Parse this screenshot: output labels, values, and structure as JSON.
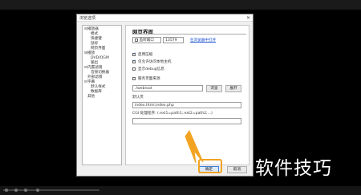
{
  "dialog": {
    "title": "浏览选项",
    "close_glyph": "✕"
  },
  "tree": {
    "items": [
      {
        "label": "播放器",
        "toggle": "⊟",
        "indent": 0
      },
      {
        "label": "模式",
        "toggle": "",
        "indent": 1
      },
      {
        "label": "快捷键",
        "toggle": "",
        "indent": 1
      },
      {
        "label": "鼠标",
        "toggle": "",
        "indent": 1
      },
      {
        "label": "网页界面",
        "toggle": "",
        "indent": 1
      },
      {
        "label": "播放",
        "toggle": "⊞",
        "indent": 0
      },
      {
        "label": "DVD/OGM",
        "toggle": "",
        "indent": 1
      },
      {
        "label": "输出",
        "toggle": "",
        "indent": 1
      },
      {
        "label": "内置滤镜",
        "toggle": "⊟",
        "indent": 0
      },
      {
        "label": "音频切换器",
        "toggle": "",
        "indent": 1
      },
      {
        "label": "外部滤镜",
        "toggle": "",
        "indent": 0
      },
      {
        "label": "字幕",
        "toggle": "⊟",
        "indent": 0
      },
      {
        "label": "默认样式",
        "toggle": "",
        "indent": 1
      },
      {
        "label": "数据库",
        "toggle": "",
        "indent": 1
      },
      {
        "label": "其他",
        "toggle": "",
        "indent": 0
      }
    ]
  },
  "panel": {
    "heading": "网页界面",
    "listen_port": {
      "label": "监听端口",
      "value": "13579",
      "checked": false
    },
    "open_link": "在浏览器中打开",
    "options": [
      {
        "label": "启用压缩",
        "checked": true
      },
      {
        "label": "仅允许访问本地主机",
        "checked": true
      },
      {
        "label": "显示debug信息",
        "checked": false
      }
    ],
    "serve_pages": {
      "label": "服务页面来源",
      "checked": false
    },
    "path_value": "./webroot",
    "browse_button": "浏览",
    "deploy_button": "展开",
    "default_page_label": "默认页",
    "default_page_value": "index.html;index.php",
    "cgi_label": "CGI 处理程序: (.ext1=path1;.ext2=path2;...)",
    "cgi_value": ""
  },
  "footer": {
    "ok_label": "确定",
    "cancel_label": "取消"
  },
  "watermark": "软件技巧",
  "colors": {
    "accent": "#f2a322",
    "link": "#1a4fd4",
    "ok_button": "#dbe8f8"
  }
}
